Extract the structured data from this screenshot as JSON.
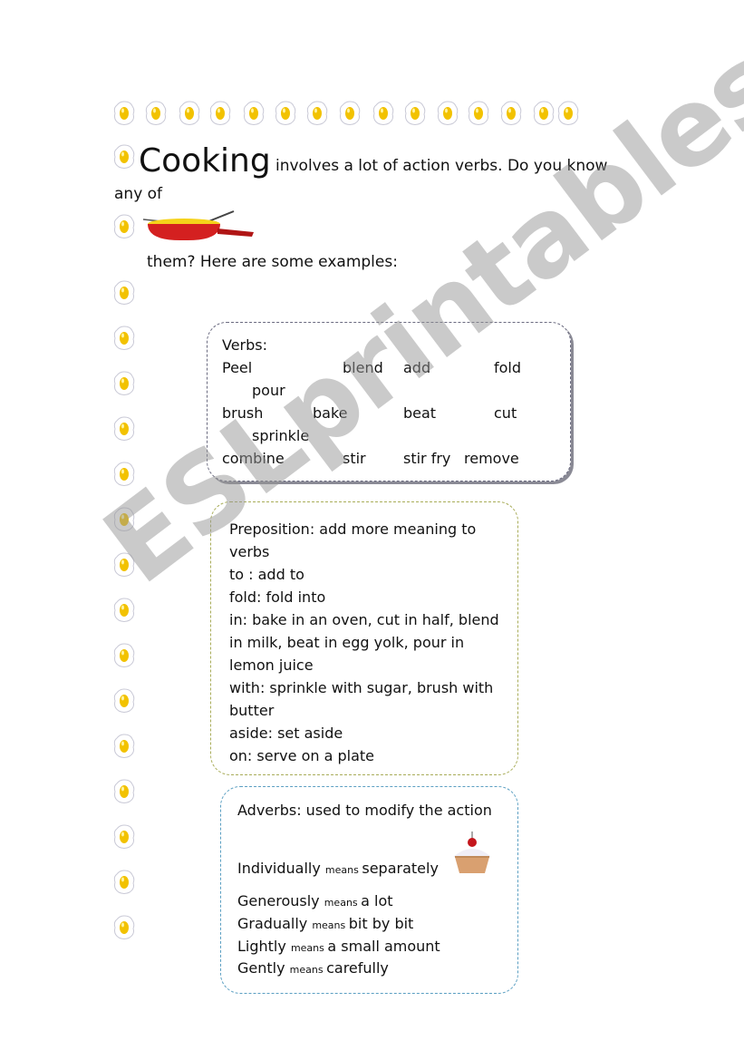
{
  "intro": {
    "title_word": "Cooking",
    "line1_rest": "involves a lot of action verbs. Do you know",
    "line2": "any of",
    "line3": "them? Here are some examples:"
  },
  "verbs_box": {
    "heading": "Verbs:",
    "words": [
      "Peel",
      "blend",
      "add",
      "fold",
      "pour",
      "brush",
      "bake",
      "beat",
      "cut",
      "sprinkle",
      "combine",
      "stir",
      "stir fry",
      "remove"
    ]
  },
  "preposition_box": {
    "lines": [
      "Preposition: add more meaning to",
      "verbs",
      "to : add to",
      "fold: fold into",
      "in: bake in an oven, cut in half, blend",
      "in milk, beat in egg yolk, pour in",
      "lemon juice",
      "with: sprinkle with sugar, brush with",
      "butter",
      "aside: set aside",
      "on: serve on a plate"
    ]
  },
  "adverbs_box": {
    "heading": "Adverbs: used to modify the action",
    "connector": "means",
    "items": [
      {
        "term": "Individually",
        "definition": "separately"
      },
      {
        "term": "Generously",
        "definition": "a lot"
      },
      {
        "term": "Gradually",
        "definition": "bit by bit"
      },
      {
        "term": "Lightly",
        "definition": "a small amount"
      },
      {
        "term": "Gently",
        "definition": "carefully"
      }
    ]
  },
  "watermark": "ESLprintables.com",
  "colors": {
    "egg_yolk": "#f2c200",
    "verbs_border": "#6b6b80",
    "preposition_border": "#a9ad5a",
    "adverbs_border": "#5b9fc2",
    "pan": "#d42020"
  }
}
